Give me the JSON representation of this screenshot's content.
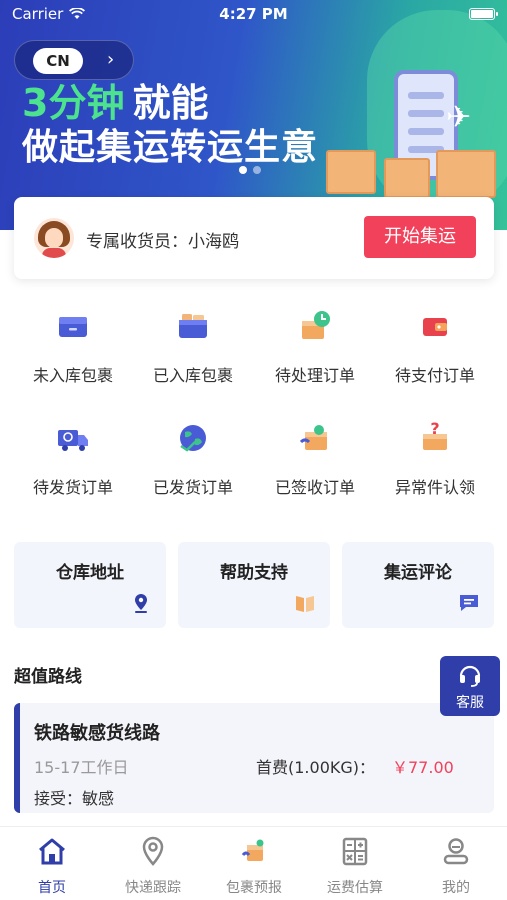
{
  "status_bar": {
    "carrier": "Carrier",
    "time": "4:27 PM"
  },
  "banner": {
    "region_label": "CN",
    "headline_em": "3分钟",
    "headline_rest": "就能",
    "headline_line2": "做起集运转运生意",
    "slide_count": 2,
    "active_slide": 1
  },
  "receiver": {
    "label": "专属收货员：小海鸥",
    "start_button": "开始集运"
  },
  "order_entries": [
    {
      "label": "未入库包裹",
      "icon": "inbox-icon"
    },
    {
      "label": "已入库包裹",
      "icon": "stored-box-icon"
    },
    {
      "label": "待处理订单",
      "icon": "pending-order-icon"
    },
    {
      "label": "待支付订单",
      "icon": "wallet-icon"
    },
    {
      "label": "待发货订单",
      "icon": "truck-icon"
    },
    {
      "label": "已发货订单",
      "icon": "globe-icon"
    },
    {
      "label": "已签收订单",
      "icon": "signed-box-icon"
    },
    {
      "label": "异常件认领",
      "icon": "question-box-icon"
    }
  ],
  "quick_links": [
    {
      "label": "仓库地址",
      "icon": "location-pin-icon"
    },
    {
      "label": "帮助支持",
      "icon": "book-icon"
    },
    {
      "label": "集运评论",
      "icon": "comment-icon"
    }
  ],
  "routes_section": {
    "title": "超值路线"
  },
  "route": {
    "name": "铁路敏感货线路",
    "days": "15-17工作日",
    "fee_label": "首费(1.00KG)：",
    "fee": "￥77.00",
    "accept": "接受：敏感"
  },
  "customer_service": {
    "label": "客服"
  },
  "tabs": [
    {
      "label": "首页",
      "icon": "home-icon",
      "active": true
    },
    {
      "label": "快递跟踪",
      "icon": "tracking-pin-icon",
      "active": false
    },
    {
      "label": "包裹预报",
      "icon": "parcel-forecast-icon",
      "active": false
    },
    {
      "label": "运费估算",
      "icon": "calculator-icon",
      "active": false
    },
    {
      "label": "我的",
      "icon": "profile-icon",
      "active": false
    }
  ],
  "colors": {
    "accent": "#2f3ea8",
    "primary_button": "#f2415a",
    "price": "#f2415a",
    "headline_highlight": "#4de38e"
  }
}
